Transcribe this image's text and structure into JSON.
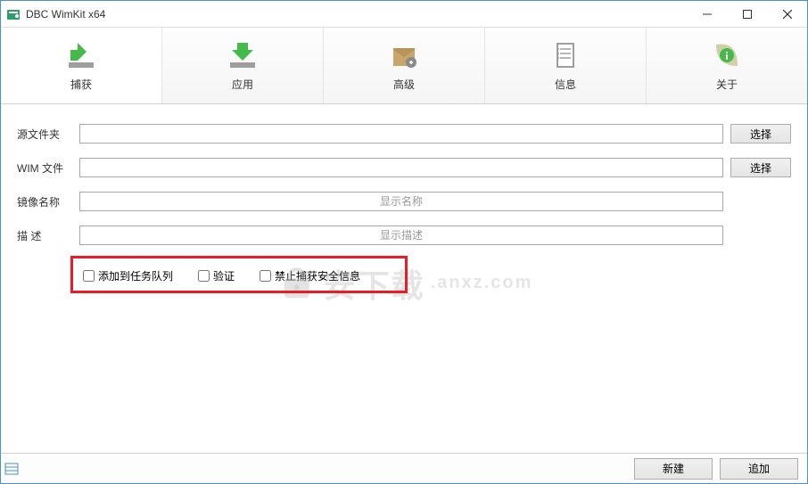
{
  "window": {
    "title": "DBC WimKit x64"
  },
  "toolbar": {
    "capture": "捕获",
    "apply": "应用",
    "advanced": "高级",
    "info": "信息",
    "about": "关于"
  },
  "form": {
    "source_folder_label": "源文件夹",
    "source_folder_value": "",
    "wim_file_label": "WIM 文件",
    "wim_file_value": "",
    "image_name_label": "镜像名称",
    "image_name_value": "",
    "image_name_placeholder": "显示名称",
    "description_label": "描   述",
    "description_value": "",
    "description_placeholder": "显示描述",
    "select_btn": "选择"
  },
  "checkboxes": {
    "add_to_queue": "添加到任务队列",
    "verify": "验证",
    "no_security": "禁止捕获安全信息"
  },
  "footer": {
    "new_btn": "新建",
    "append_btn": "追加"
  },
  "watermark": "安下载"
}
